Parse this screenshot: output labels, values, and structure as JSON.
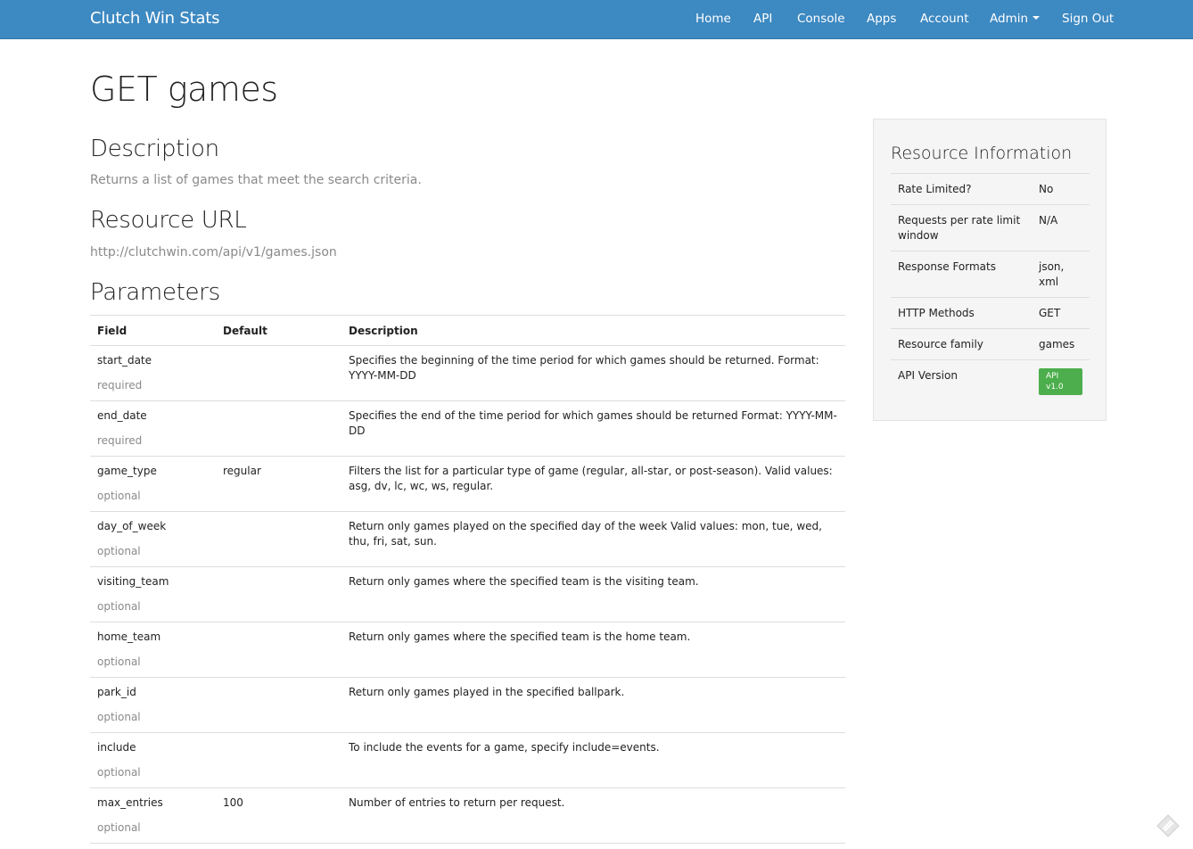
{
  "navbar": {
    "brand": "Clutch Win Stats",
    "items": [
      {
        "label": "Home"
      },
      {
        "label": "API"
      },
      {
        "label": "Console"
      },
      {
        "label": "Apps"
      },
      {
        "label": "Account"
      },
      {
        "label": "Admin"
      },
      {
        "label": "Sign Out"
      }
    ]
  },
  "page": {
    "title": "GET games",
    "description_heading": "Description",
    "description_text": "Returns a list of games that meet the search criteria.",
    "resource_url_heading": "Resource URL",
    "resource_url": "http://clutchwin.com/api/v1/games.json",
    "parameters_heading": "Parameters"
  },
  "parameters": {
    "headers": {
      "field": "Field",
      "default": "Default",
      "description": "Description"
    },
    "rows": [
      {
        "field": "start_date",
        "requirement": "required",
        "default": "",
        "description": "Specifies the beginning of the time period for which games should be returned. Format: YYYY-MM-DD"
      },
      {
        "field": "end_date",
        "requirement": "required",
        "default": "",
        "description": "Specifies the end of the time period for which games should be returned Format: YYYY-MM-DD"
      },
      {
        "field": "game_type",
        "requirement": "optional",
        "default": "regular",
        "description": "Filters the list for a particular type of game (regular, all-star, or post-season). Valid values: asg, dv, lc, wc, ws, regular."
      },
      {
        "field": "day_of_week",
        "requirement": "optional",
        "default": "",
        "description": "Return only games played on the specified day of the week Valid values: mon, tue, wed, thu, fri, sat, sun."
      },
      {
        "field": "visiting_team",
        "requirement": "optional",
        "default": "",
        "description": "Return only games where the specified team is the visiting team."
      },
      {
        "field": "home_team",
        "requirement": "optional",
        "default": "",
        "description": "Return only games where the specified team is the home team."
      },
      {
        "field": "park_id",
        "requirement": "optional",
        "default": "",
        "description": "Return only games played in the specified ballpark."
      },
      {
        "field": "include",
        "requirement": "optional",
        "default": "",
        "description": "To include the events for a game, specify include=events."
      },
      {
        "field": "max_entries",
        "requirement": "optional",
        "default": "100",
        "description": "Number of entries to return per request."
      }
    ]
  },
  "resource_info": {
    "title": "Resource Information",
    "rows": [
      {
        "key": "Rate Limited?",
        "value": "No"
      },
      {
        "key": "Requests per rate limit window",
        "value": "N/A"
      },
      {
        "key": "Response Formats",
        "value": "json, xml"
      },
      {
        "key": "HTTP Methods",
        "value": "GET"
      },
      {
        "key": "Resource family",
        "value": "games"
      },
      {
        "key": "API Version",
        "value": "API v1.0"
      }
    ]
  },
  "icons": {
    "admin_dropdown": "caret-down-icon",
    "corner": "feedback-icon"
  },
  "colors": {
    "navbar_bg": "#3d89c2",
    "badge_green": "#4cae4c",
    "muted_text": "#8a8a8a"
  }
}
